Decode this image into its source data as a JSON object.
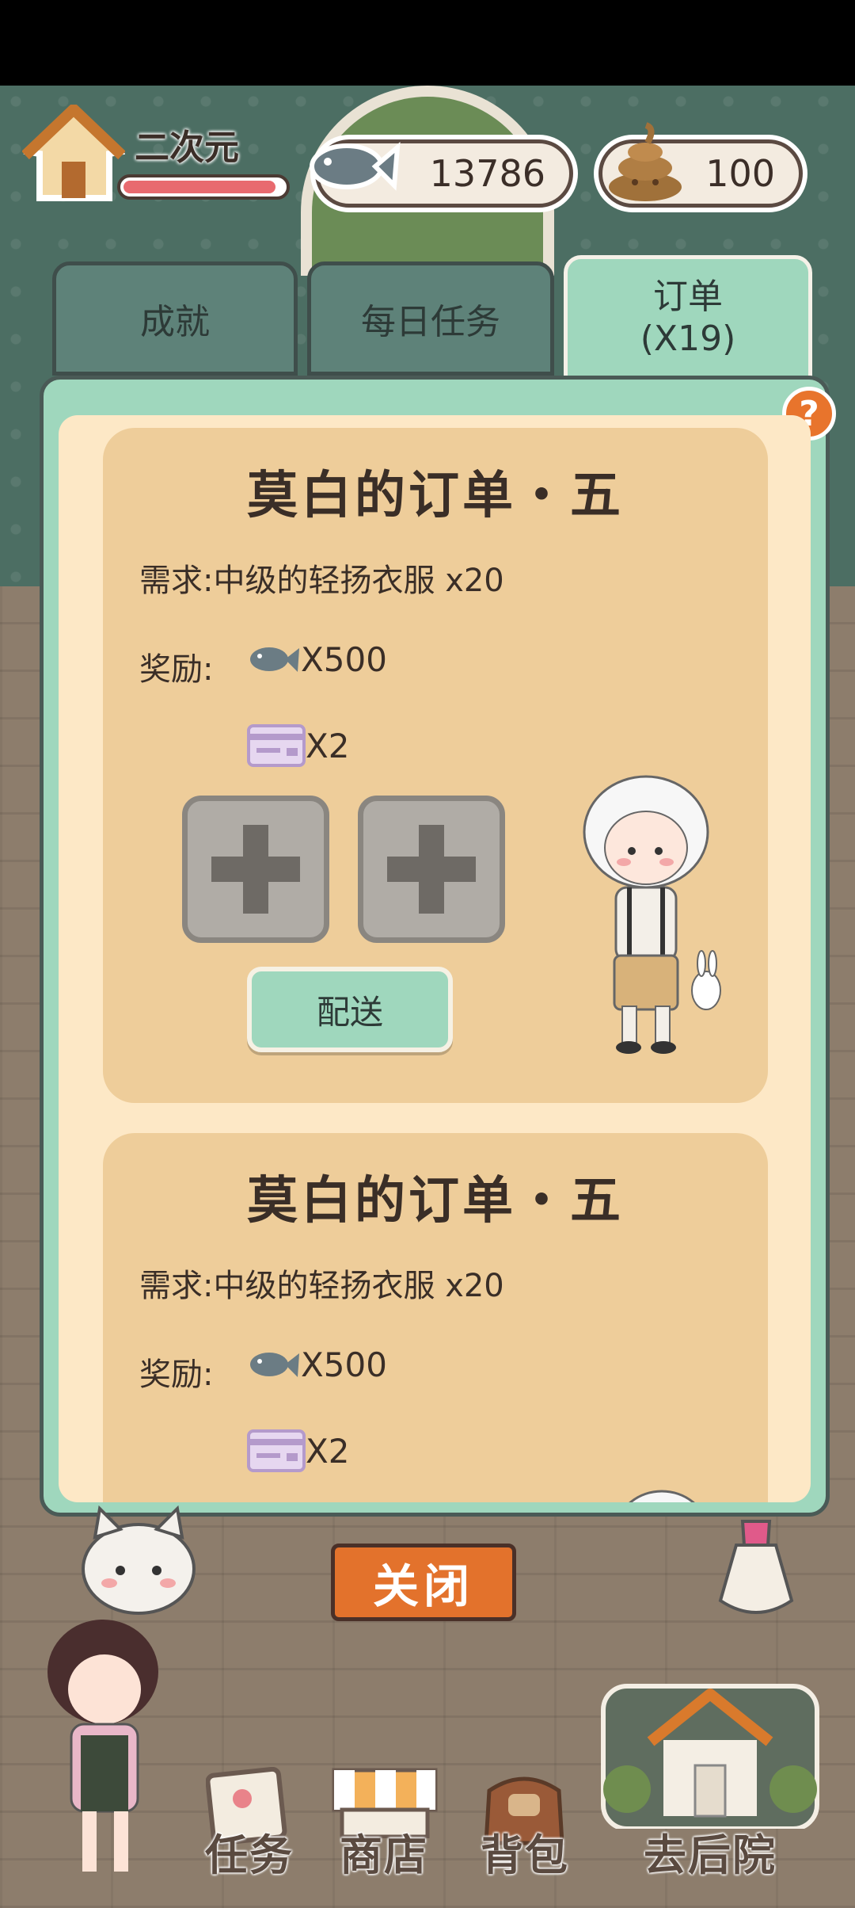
{
  "hud": {
    "player_name": "二次元",
    "health_level": 0.95,
    "fish_count": "13786",
    "poop_count": "100"
  },
  "tabs": [
    {
      "label": "成就"
    },
    {
      "label": "每日任务"
    },
    {
      "label": "订单",
      "sub": "(X19)"
    }
  ],
  "help_label": "?",
  "orders": [
    {
      "title": "莫白的订单・五",
      "requirement": "需求:中级的轻扬衣服 x20",
      "reward_label": "奖励:",
      "reward_fish": "X500",
      "reward_card": "X2",
      "deliver_label": "配送"
    },
    {
      "title": "莫白的订单・五",
      "requirement": "需求:中级的轻扬衣服 x20",
      "reward_label": "奖励:",
      "reward_fish": "X500",
      "reward_card": "X2"
    }
  ],
  "close_label": "关闭",
  "nav": {
    "tasks": "任务",
    "shop": "商店",
    "bag": "背包",
    "backyard": "去后院"
  },
  "colors": {
    "panel_green": "#9fd7bd",
    "card_tan": "#eecd9a",
    "close_orange": "#e3722c",
    "help_orange": "#e8742c"
  }
}
